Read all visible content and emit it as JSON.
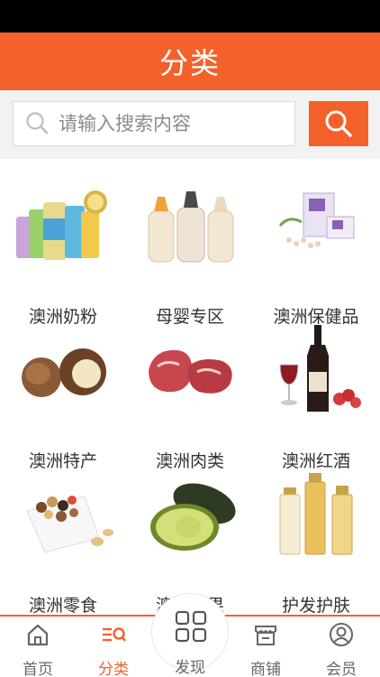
{
  "header": {
    "title": "分类"
  },
  "search": {
    "placeholder": "请输入搜索内容",
    "icon": "search-icon",
    "button_icon": "search-icon"
  },
  "colors": {
    "accent": "#f4612b",
    "text": "#333333",
    "muted": "#8a8a8a"
  },
  "categories": [
    {
      "label": "澳洲奶粉",
      "icon": "milk-powder-cans"
    },
    {
      "label": "母婴专区",
      "icon": "baby-bottles"
    },
    {
      "label": "澳洲保健品",
      "icon": "health-supplement-box"
    },
    {
      "label": "澳洲特产",
      "icon": "macadamia-nuts"
    },
    {
      "label": "澳洲肉类",
      "icon": "raw-meat"
    },
    {
      "label": "澳洲红酒",
      "icon": "red-wine"
    },
    {
      "label": "澳洲零食",
      "icon": "mixed-nuts-bowl"
    },
    {
      "label": "澳洲水果",
      "icon": "avocado"
    },
    {
      "label": "护发护肤",
      "icon": "skincare-bottles"
    }
  ],
  "tabs": [
    {
      "label": "首页",
      "icon": "home-icon"
    },
    {
      "label": "分类",
      "icon": "category-icon",
      "active": true
    },
    {
      "label": "发现",
      "icon": "grid-icon"
    },
    {
      "label": "商铺",
      "icon": "shop-icon"
    },
    {
      "label": "会员",
      "icon": "user-icon"
    }
  ]
}
